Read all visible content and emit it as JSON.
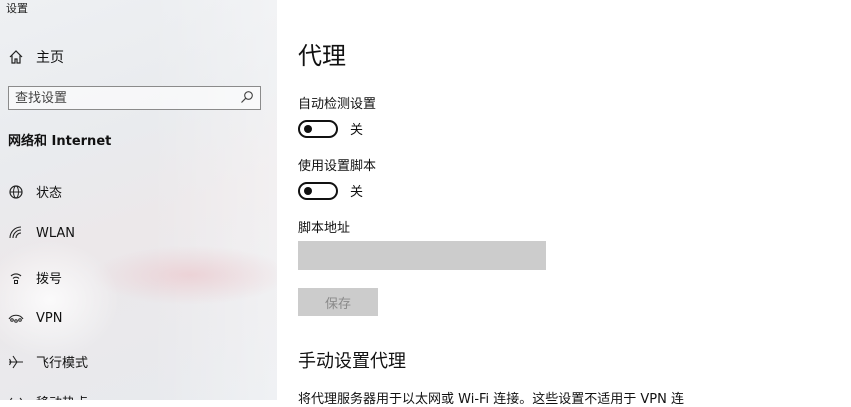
{
  "window": {
    "title": "设置"
  },
  "sidebar": {
    "home_label": "主页",
    "search_placeholder": "查找设置",
    "section_title": "网络和 Internet",
    "items": [
      {
        "label": "状态",
        "icon": "globe-icon"
      },
      {
        "label": "WLAN",
        "icon": "wifi-icon"
      },
      {
        "label": "拨号",
        "icon": "dialup-icon"
      },
      {
        "label": "VPN",
        "icon": "vpn-icon"
      },
      {
        "label": "飞行模式",
        "icon": "airplane-icon"
      },
      {
        "label": "移动热点",
        "icon": "hotspot-icon"
      }
    ]
  },
  "main": {
    "title": "代理",
    "auto_detect": {
      "label": "自动检测设置",
      "state": "关",
      "on": false
    },
    "use_script": {
      "label": "使用设置脚本",
      "state": "关",
      "on": false
    },
    "script_address": {
      "label": "脚本地址",
      "value": ""
    },
    "save_button": "保存",
    "manual_title": "手动设置代理",
    "manual_desc": "将代理服务器用于以太网或 Wi-Fi 连接。这些设置不适用于 VPN 连"
  }
}
